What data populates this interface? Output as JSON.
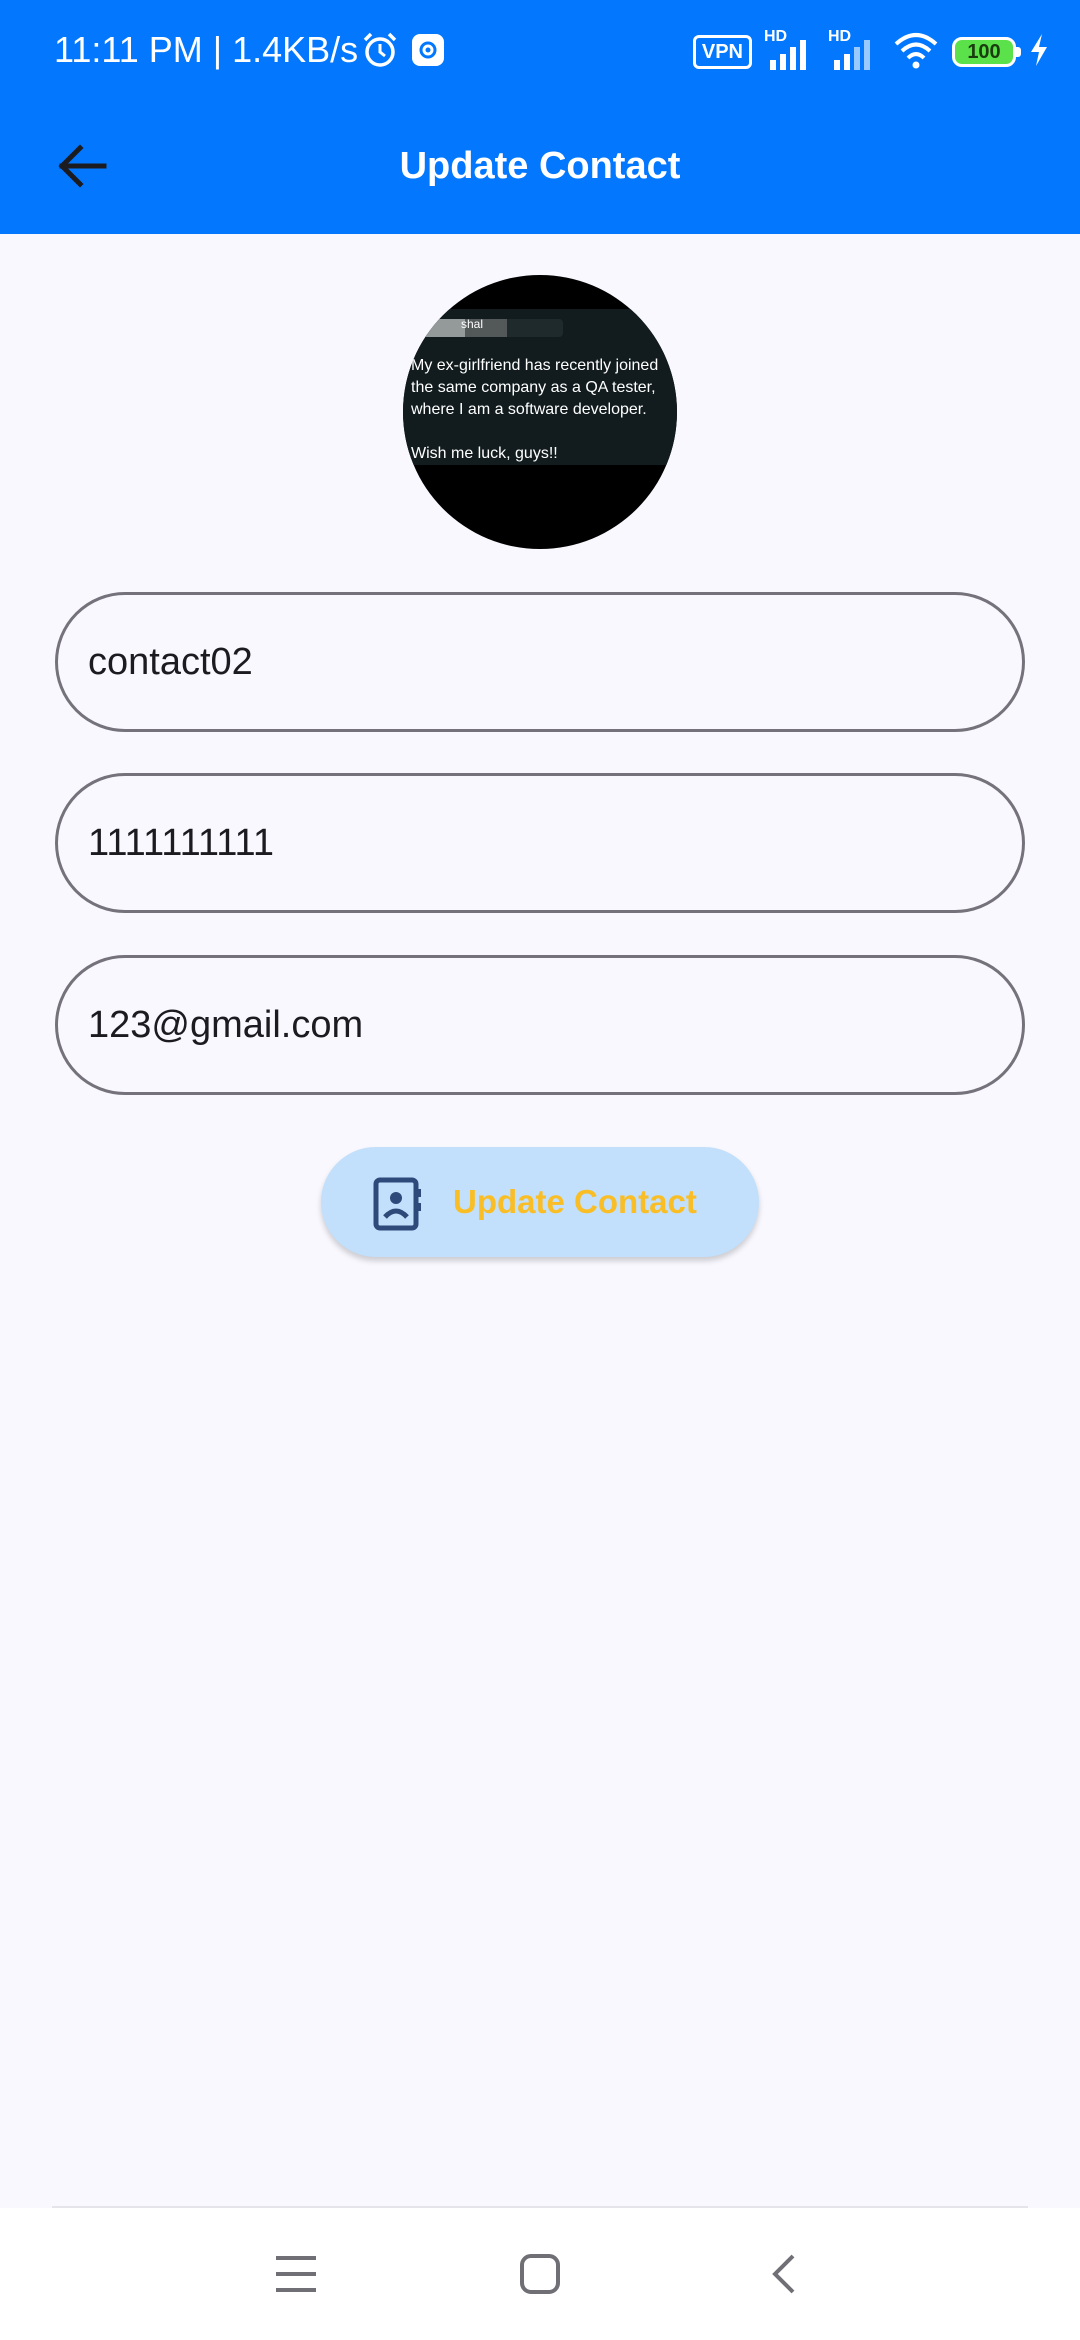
{
  "status_bar": {
    "time_speed": "11:11 PM | 1.4KB/s",
    "vpn": "VPN",
    "signal1_label": "HD",
    "signal2_label": "HD",
    "battery": "100"
  },
  "toolbar": {
    "title": "Update Contact",
    "back_icon": "arrow-left-icon"
  },
  "avatar": {
    "username_fragment": "shal",
    "caption": "My ex-girlfriend has recently joined\nthe same company as a QA tester,\nwhere  I am a software developer.\n\nWish me luck, guys!!"
  },
  "form": {
    "name_value": "contact02",
    "phone_value": "1111111111",
    "email_value": "123@gmail.com"
  },
  "update_button": {
    "label": "Update Contact",
    "icon": "contact-card-icon",
    "label_color": "#F9BE25",
    "bg_color": "#C2DFFB"
  },
  "colors": {
    "app_bar": "#0378FF",
    "background": "#F8F8FE",
    "field_border": "#75727B"
  },
  "nav_bar": {
    "icons": [
      "menu-icon",
      "home-icon",
      "back-icon"
    ]
  }
}
